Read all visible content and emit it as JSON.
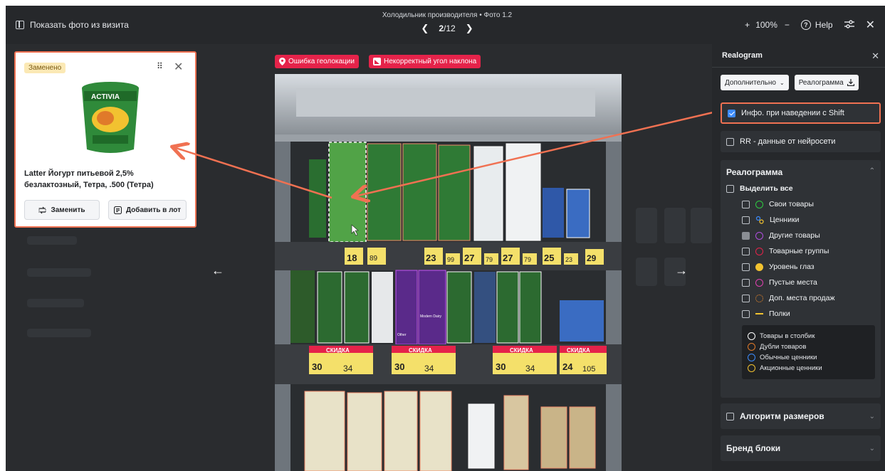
{
  "topbar": {
    "show_visit_label": "Показать фото из визита",
    "photo_title": "Холодильник производителя • Фото 1.2",
    "pager_current": "2",
    "pager_total": "/12",
    "zoom": "100%",
    "zoom_plus": "+",
    "zoom_minus": "−",
    "help_label": "Help"
  },
  "tags": {
    "geo": "Ошибка геолокации",
    "angle": "Некорректный угол наклона"
  },
  "popup": {
    "badge": "Заменено",
    "product_name": "Latter Йогурт питьевой 2,5% безлактозный, Тетра, .500 (Тетра)",
    "replace_btn": "Заменить",
    "add_lot_btn": "Добавить в лот"
  },
  "photo": {
    "price_tags": [
      {
        "big": "18",
        "small": "89"
      },
      {
        "big": "23",
        "small": "99"
      },
      {
        "big": "27",
        "small": "79"
      },
      {
        "big": "27",
        "small": "79"
      },
      {
        "big": "25",
        "small": "23"
      },
      {
        "big": "29",
        "small": ""
      }
    ],
    "discount_label": "СКИДКА",
    "discount_prices": [
      {
        "old": "30",
        "new": "34"
      },
      {
        "old": "30",
        "new": "34"
      },
      {
        "old": "30",
        "new": "34"
      },
      {
        "old": "24",
        "new": "105"
      }
    ],
    "label_other": "Other",
    "label_modern_dairy": "Modern Dairy"
  },
  "sidebar": {
    "title": "Realogram",
    "btn_more": "Дополнительно",
    "btn_realogram": "Реалограмма",
    "info_shift": "Инфо. при наведении с Shift",
    "rr_data": "RR - данные от нейросети",
    "realogram_title": "Реалограмма",
    "select_all": "Выделить все",
    "items": [
      {
        "label": "Свои товары",
        "color": "#2ecc40",
        "style": "ring",
        "checked": false
      },
      {
        "label": "Ценники",
        "color": "#3d8bfd",
        "style": "price",
        "checked": false
      },
      {
        "label": "Другие товары",
        "color": "#b14ee0",
        "style": "ring",
        "checked": true
      },
      {
        "label": "Товарные группы",
        "color": "#e5234a",
        "style": "ring",
        "checked": false
      },
      {
        "label": "Уровень глаз",
        "color": "#f2c230",
        "style": "filled",
        "checked": false
      },
      {
        "label": "Пустые места",
        "color": "#e040b0",
        "style": "ring",
        "checked": false
      },
      {
        "label": "Доп. места продаж",
        "color": "#f08a2a",
        "style": "dashed",
        "checked": false
      },
      {
        "label": "Полки",
        "color": "#f2c230",
        "style": "line",
        "checked": false
      }
    ],
    "legend": [
      {
        "label": "Товары в столбик",
        "color": "#ffffff"
      },
      {
        "label": "Дубли товаров",
        "color": "#e07a2a"
      },
      {
        "label": "Обычные ценники",
        "color": "#3d8bfd"
      },
      {
        "label": "Акционные ценники",
        "color": "#f2c230"
      }
    ],
    "alg_sizes": "Алгоритм размеров",
    "brand_blocks": "Бренд блоки"
  },
  "colors": {
    "accent_orange": "#f07152",
    "tag_red": "#e5234a",
    "check_blue": "#3d8bfd"
  }
}
